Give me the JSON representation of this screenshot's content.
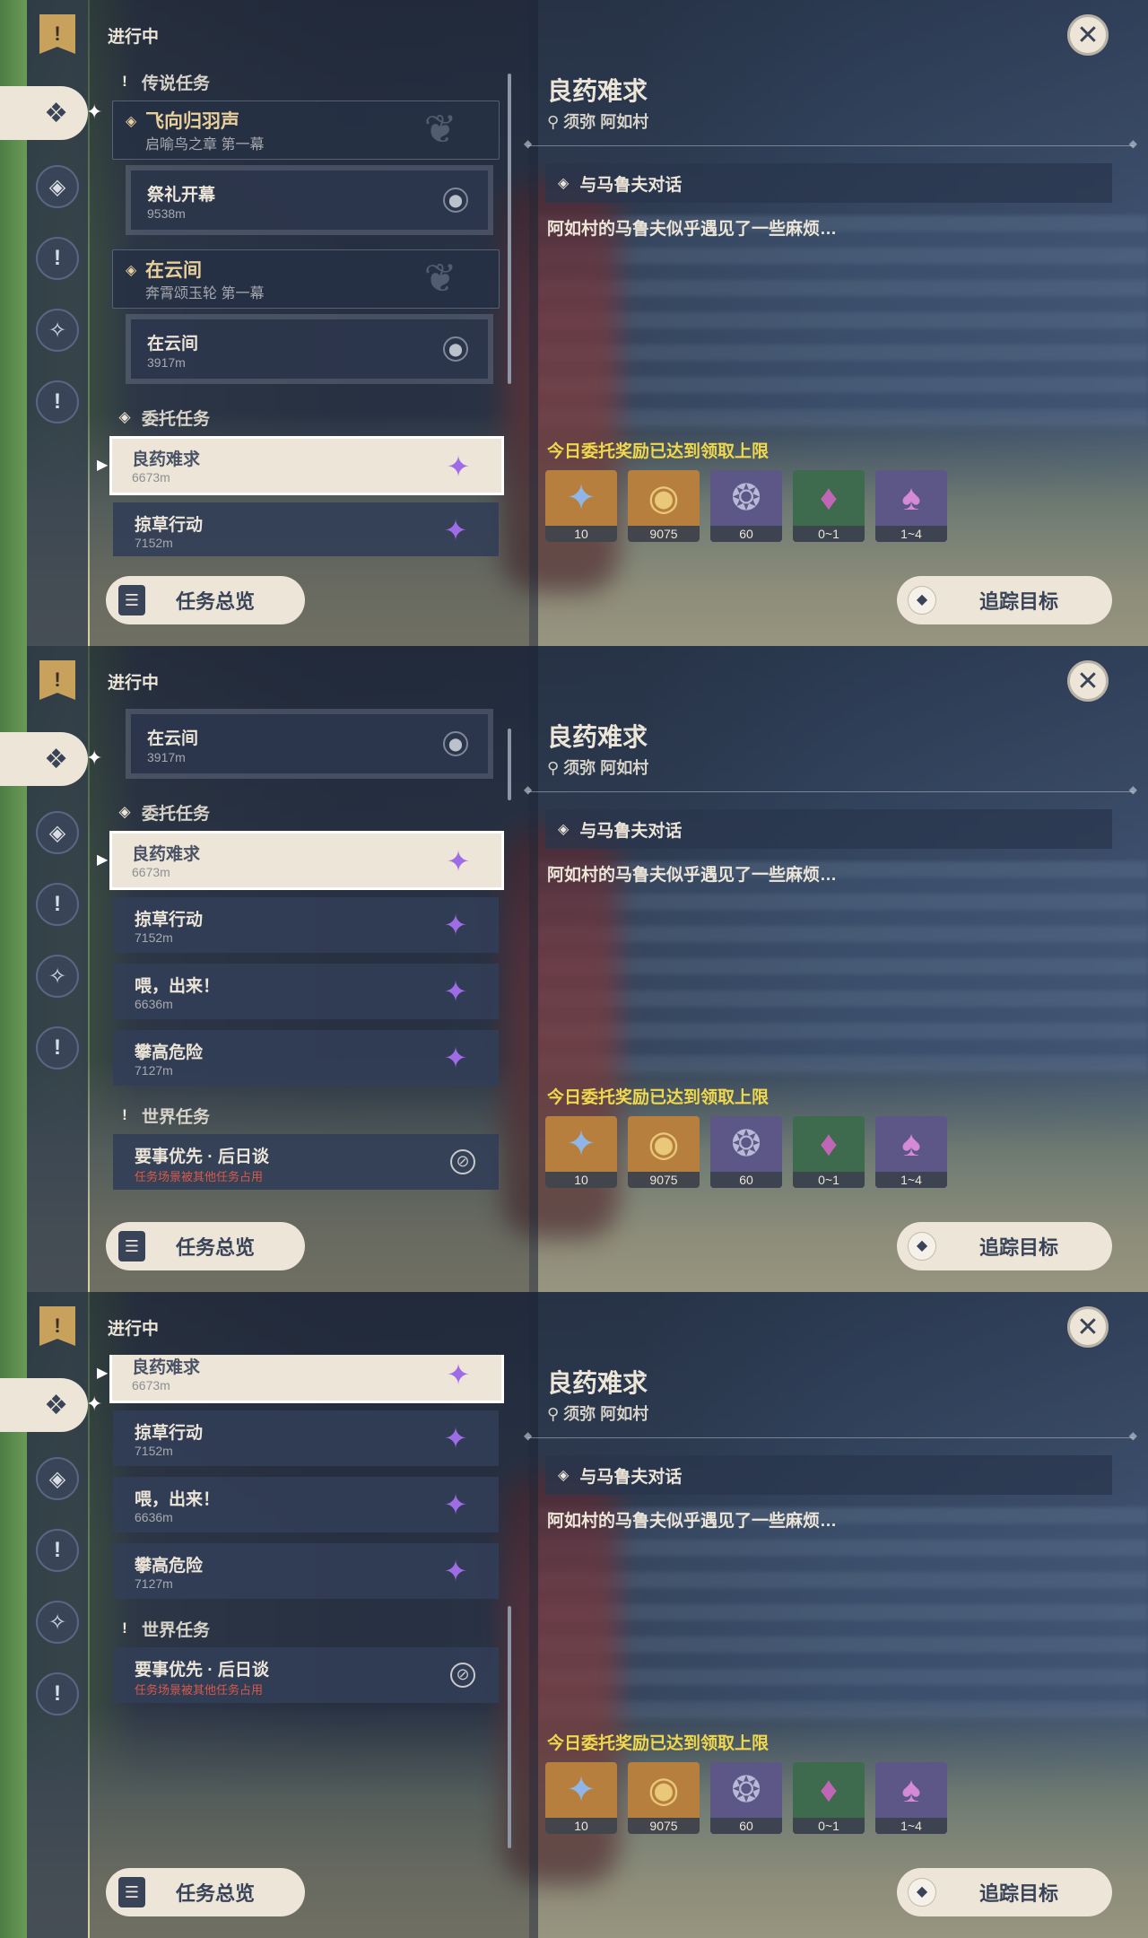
{
  "frames": [
    {
      "progress_label": "进行中",
      "sections": [
        {
          "type": "legend_header",
          "label": "传说任务"
        },
        {
          "type": "legend",
          "title": "飞向归羽声",
          "subtitle": "启喻鸟之章 第一幕"
        },
        {
          "type": "sub",
          "title": "祭礼开幕",
          "subtitle": "9538m"
        },
        {
          "type": "legend",
          "title": "在云间",
          "subtitle": "奔霄颂玉轮 第一幕"
        },
        {
          "type": "sub",
          "title": "在云间",
          "subtitle": "3917m"
        },
        {
          "type": "commission_header",
          "label": "委托任务"
        },
        {
          "type": "item",
          "title": "良药难求",
          "subtitle": "6673m",
          "selected": true
        },
        {
          "type": "item",
          "title": "掠草行动",
          "subtitle": "7152m"
        }
      ]
    },
    {
      "progress_label": "进行中",
      "sections": [
        {
          "type": "sub",
          "title": "在云间",
          "subtitle": "3917m"
        },
        {
          "type": "commission_header",
          "label": "委托任务"
        },
        {
          "type": "item",
          "title": "良药难求",
          "subtitle": "6673m",
          "selected": true
        },
        {
          "type": "item",
          "title": "掠草行动",
          "subtitle": "7152m"
        },
        {
          "type": "item",
          "title": "喂，出来！",
          "subtitle": "6636m"
        },
        {
          "type": "item",
          "title": "攀高危险",
          "subtitle": "7127m"
        },
        {
          "type": "world_header",
          "label": "世界任务"
        },
        {
          "type": "item_blocked",
          "title": "要事优先 · 后日谈",
          "warning": "任务场景被其他任务占用"
        }
      ]
    },
    {
      "progress_label": "进行中",
      "sections": [
        {
          "type": "item",
          "title": "良药难求",
          "subtitle": "6673m",
          "selected": true
        },
        {
          "type": "item",
          "title": "掠草行动",
          "subtitle": "7152m"
        },
        {
          "type": "item",
          "title": "喂，出来！",
          "subtitle": "6636m"
        },
        {
          "type": "item",
          "title": "攀高危险",
          "subtitle": "7127m"
        },
        {
          "type": "world_header",
          "label": "世界任务"
        },
        {
          "type": "item_blocked",
          "title": "要事优先 · 后日谈",
          "warning": "任务场景被其他任务占用"
        }
      ]
    }
  ],
  "detail": {
    "title": "良药难求",
    "location": "须弥 阿如村",
    "objective": "与马鲁夫对话",
    "description": "阿如村的马鲁夫似乎遇见了一些麻烦…",
    "reward_note": "今日委托奖励已达到领取上限",
    "rewards": [
      {
        "icon": "adventure-exp-icon",
        "count": "10",
        "tone": "gold"
      },
      {
        "icon": "mora-icon",
        "count": "9075",
        "tone": "gold"
      },
      {
        "icon": "friendship-exp-icon",
        "count": "60",
        "tone": "purple"
      },
      {
        "icon": "crystal-chunk-icon",
        "count": "0~1",
        "tone": "green"
      },
      {
        "icon": "crystal-cluster-icon",
        "count": "1~4",
        "tone": "purple"
      }
    ]
  },
  "buttons": {
    "overview": "任务总览",
    "track": "追踪目标"
  },
  "colors": {
    "cream": "#ece5d8",
    "panel_dark": "#2c364c",
    "gold_text": "#e8cf9b",
    "commission_star": "#9f6ce8",
    "reward_limit": "#f0d84c",
    "warning": "#d65a4a"
  }
}
